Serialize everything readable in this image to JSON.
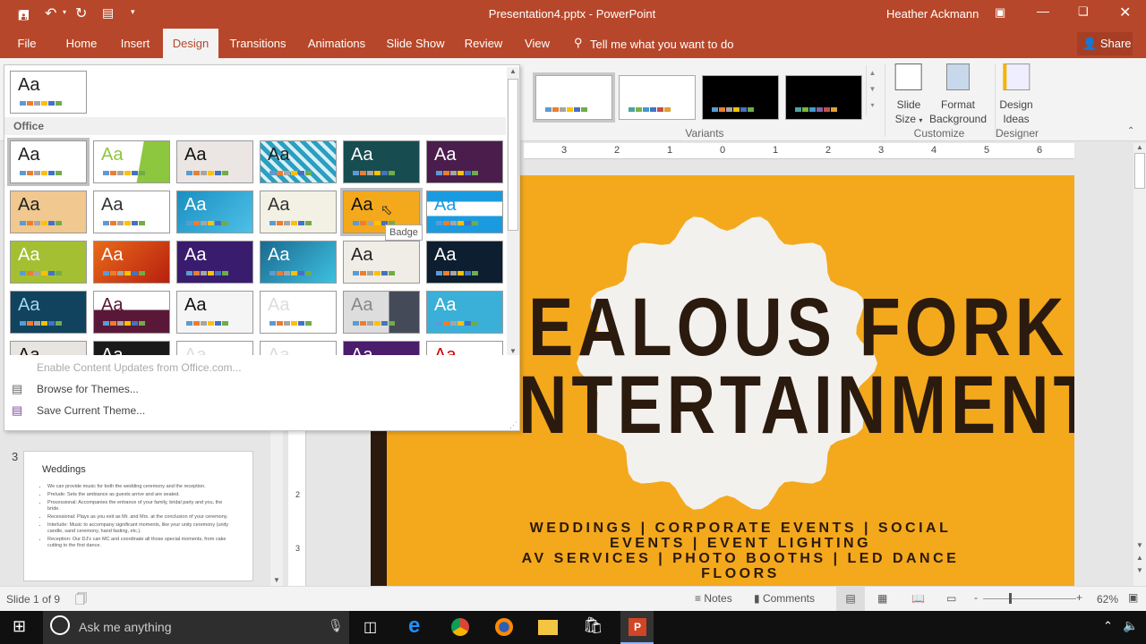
{
  "titlebar": {
    "title": "Presentation4.pptx - PowerPoint",
    "user": "Heather Ackmann",
    "qat": [
      "save-icon",
      "undo-icon",
      "redo-icon",
      "start-from-beginning-icon",
      "customize-qat-icon"
    ]
  },
  "tabs": [
    {
      "label": "File"
    },
    {
      "label": "Home"
    },
    {
      "label": "Insert"
    },
    {
      "label": "Design",
      "active": true
    },
    {
      "label": "Transitions"
    },
    {
      "label": "Animations"
    },
    {
      "label": "Slide Show"
    },
    {
      "label": "Review"
    },
    {
      "label": "View"
    }
  ],
  "tell_me": "Tell me what you want to do",
  "share": "Share",
  "ribbon": {
    "variants_label": "Variants",
    "customize_label": "Customize",
    "designer_label": "Designer",
    "slide_size": [
      "Slide",
      "Size"
    ],
    "format_background": [
      "Format",
      "Background"
    ],
    "design_ideas": [
      "Design",
      "Ideas"
    ],
    "variants": [
      {
        "bg": "#ffffff",
        "sw": [
          "#5b9bd5",
          "#ed7d31",
          "#a5a5a5",
          "#ffc000",
          "#4472c4",
          "#70ad47"
        ]
      },
      {
        "bg": "#ffffff",
        "sw": [
          "#4aa3a3",
          "#7cb342",
          "#3e9bcf",
          "#4472c4",
          "#c0504d",
          "#e0a030"
        ]
      },
      {
        "bg": "#000000",
        "sw": [
          "#5b9bd5",
          "#ed7d31",
          "#a5a5a5",
          "#ffc000",
          "#4472c4",
          "#70ad47"
        ]
      },
      {
        "bg": "#000000",
        "sw": [
          "#4aa3a3",
          "#7cb342",
          "#3e9bcf",
          "#8064a2",
          "#c0504d",
          "#e0a030"
        ]
      }
    ]
  },
  "gallery": {
    "section": "Office",
    "tooltip": "Badge",
    "themes": [
      {
        "bg": "#ffffff",
        "fg": "#222"
      },
      {
        "bg": "linear-gradient(100deg,#fff 60%,#8dc63f 61%)",
        "fg": "#8dc63f"
      },
      {
        "bg": "#ebe6e3",
        "fg": "#111"
      },
      {
        "bg": "repeating-linear-gradient(45deg,#2a9fc0 0 5px,#d8f0f8 5px 9px)",
        "fg": "#222"
      },
      {
        "bg": "#174c50",
        "fg": "#fff"
      },
      {
        "bg": "#4a1d4d",
        "fg": "#fff"
      },
      {
        "bg": "#f0c890",
        "fg": "#222"
      },
      {
        "bg": "#ffffff",
        "fg": "#333"
      },
      {
        "bg": "linear-gradient(135deg,#1a8fc0,#4ec0e8)",
        "fg": "#fff"
      },
      {
        "bg": "#f3f1e4",
        "fg": "#333"
      },
      {
        "bg": "#f4a81c",
        "fg": "#111"
      },
      {
        "bg": "linear-gradient(#1a9be0 25%,#fff 25% 60%,#1a9be0 60%)",
        "fg": "#1a9be0"
      },
      {
        "bg": "#a4c032",
        "fg": "#fff"
      },
      {
        "bg": "linear-gradient(135deg,#e86a1a,#b8200e)",
        "fg": "#fff"
      },
      {
        "bg": "#3a1c6e",
        "fg": "#fff"
      },
      {
        "bg": "linear-gradient(135deg,#1a6a90,#3ec0e0)",
        "fg": "#fff"
      },
      {
        "bg": "#f0ede6",
        "fg": "#222"
      },
      {
        "bg": "#0c1e30",
        "fg": "#fff"
      },
      {
        "bg": "#11435e",
        "fg": "#9fd8f0"
      },
      {
        "bg": "linear-gradient(#fff 45%,#5a1838 45%)",
        "fg": "#5a1838"
      },
      {
        "bg": "#f5f5f5",
        "fg": "#111"
      },
      {
        "bg": "#ffffff",
        "fg": "#ddd"
      },
      {
        "bg": "linear-gradient(90deg,#ddd 60%,#444a58 60%)",
        "fg": "#888"
      },
      {
        "bg": "#3ab0d8",
        "fg": "#fff"
      },
      {
        "bg": "#e8e4e0",
        "fg": "#111"
      },
      {
        "bg": "#1a1a1a",
        "fg": "#fff"
      },
      {
        "bg": "#ffffff",
        "fg": "#ddd"
      },
      {
        "bg": "#ffffff",
        "fg": "#ddd"
      },
      {
        "bg": "#4a1d6d",
        "fg": "#fff"
      },
      {
        "bg": "#ffffff",
        "fg": "#c00"
      }
    ],
    "swatches": [
      "#5b9bd5",
      "#ed7d31",
      "#a5a5a5",
      "#ffc000",
      "#4472c4",
      "#70ad47"
    ],
    "menu": [
      {
        "label": "Enable Content Updates from Office.com...",
        "disabled": true
      },
      {
        "label": "Browse for Themes..."
      },
      {
        "label": "Save Current Theme..."
      }
    ]
  },
  "ruler": {
    "ticks": [
      "3",
      "2",
      "1",
      "0",
      "1",
      "2",
      "3",
      "4",
      "5",
      "6"
    ]
  },
  "thumbnail": {
    "number": "3",
    "title": "Weddings",
    "bullets": [
      "We can provide music for both the wedding ceremony and the reception.",
      "Prelude: Sets the ambiance as guests arrive and are seated.",
      "Processional: Accompanies the entrance of your family, bridal party and you, the bride.",
      "Recessional: Plays as you exit as Mr. and Mrs. at the conclusion of your ceremony.",
      "Interlude: Music to accompany significant moments, like your unity ceremony (unity candle, sand ceremony, hand fasting, etc.).",
      "Reception: Our DJ's can MC and coordinate all those special moments, from cake cutting to the first dance."
    ]
  },
  "slide": {
    "bg": "#f4a81c",
    "text_color": "#2b1a0e",
    "title_line1": "EALOUS FORK",
    "title_line2": "NTERTAINMENT",
    "subtitle": [
      "WEDDINGS | CORPORATE EVENTS | SOCIAL",
      "EVENTS | EVENT LIGHTING",
      "AV SERVICES | PHOTO BOOTHS | LED DANCE",
      "FLOORS"
    ]
  },
  "status": {
    "slide": "Slide 1 of 9",
    "notes": "Notes",
    "comments": "Comments",
    "zoom": "62%",
    "zoom_level": 62
  },
  "taskbar": {
    "search_placeholder": "Ask me anything"
  }
}
